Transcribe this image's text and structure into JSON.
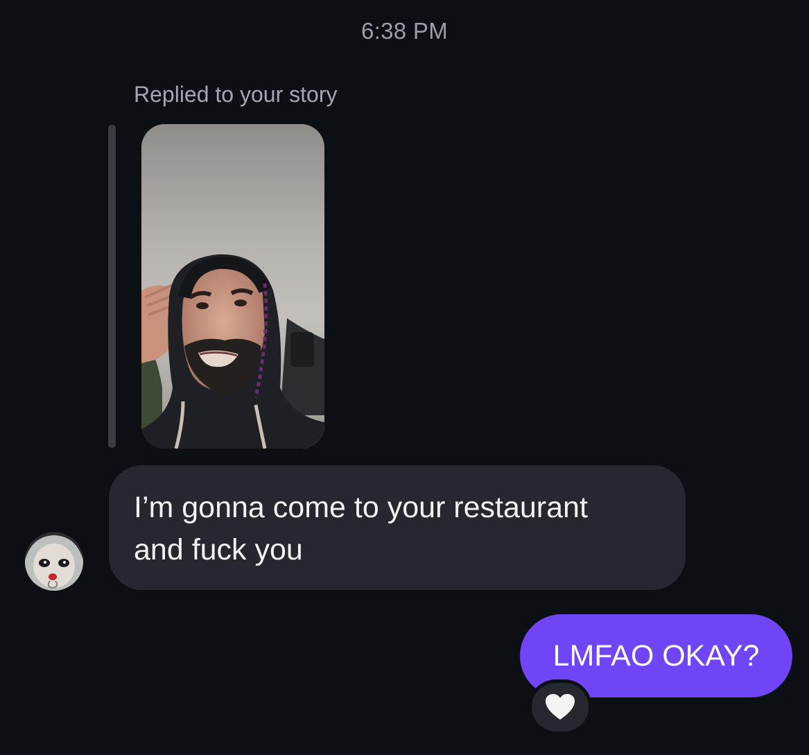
{
  "thread": {
    "timestamp": "6:38 PM",
    "reply_context": "Replied to your story"
  },
  "messages": {
    "incoming": {
      "line1": "I’m gonna come to your restaurant",
      "line2": "and fuck you"
    },
    "outgoing": {
      "text": "LMFAO OKAY?",
      "reaction_icon": "white-heart-icon"
    }
  },
  "colors": {
    "background": "#0c0f14",
    "incoming_bubble": "#25282e",
    "outgoing_bubble": "#7045f6",
    "secondary_text": "#9ba0a8"
  }
}
